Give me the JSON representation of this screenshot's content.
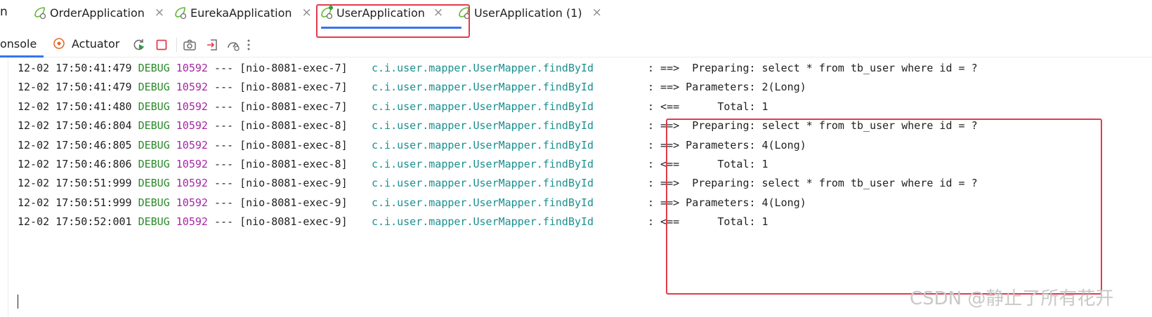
{
  "run_tabs": {
    "cut_label": "n",
    "items": [
      {
        "label": "OrderApplication",
        "close": "×"
      },
      {
        "label": "EurekaApplication",
        "close": "×"
      },
      {
        "label": "UserApplication",
        "close": "×",
        "selected": true
      },
      {
        "label": "UserApplication (1)",
        "close": "×"
      }
    ]
  },
  "toolbar": {
    "console_label": "onsole",
    "actuator_label": "Actuator",
    "icons": [
      "rerun-icon",
      "stop-icon",
      "camera-icon",
      "login-icon",
      "speed-gauge-icon",
      "more-vertical-icon"
    ]
  },
  "colors": {
    "accent": "#3574f0",
    "highlight_box": "#e23b4d",
    "debug_level": "#2a8a2a",
    "pid": "#a626a4",
    "logger": "#1b8f8f"
  },
  "log_lines": [
    {
      "ts": "12-02 17:50:41:479",
      "level": "DEBUG",
      "pid": "10592",
      "sep": "---",
      "thread": "[nio-8081-exec-7]",
      "logger": "c.i.user.mapper.UserMapper.findById",
      "msg": ": ==>  Preparing: select * from tb_user where id = ?"
    },
    {
      "ts": "12-02 17:50:41:479",
      "level": "DEBUG",
      "pid": "10592",
      "sep": "---",
      "thread": "[nio-8081-exec-7]",
      "logger": "c.i.user.mapper.UserMapper.findById",
      "msg": ": ==> Parameters: 2(Long)"
    },
    {
      "ts": "12-02 17:50:41:480",
      "level": "DEBUG",
      "pid": "10592",
      "sep": "---",
      "thread": "[nio-8081-exec-7]",
      "logger": "c.i.user.mapper.UserMapper.findById",
      "msg": ": <==      Total: 1"
    },
    {
      "ts": "12-02 17:50:46:804",
      "level": "DEBUG",
      "pid": "10592",
      "sep": "---",
      "thread": "[nio-8081-exec-8]",
      "logger": "c.i.user.mapper.UserMapper.findById",
      "msg": ": ==>  Preparing: select * from tb_user where id = ?"
    },
    {
      "ts": "12-02 17:50:46:805",
      "level": "DEBUG",
      "pid": "10592",
      "sep": "---",
      "thread": "[nio-8081-exec-8]",
      "logger": "c.i.user.mapper.UserMapper.findById",
      "msg": ": ==> Parameters: 4(Long)"
    },
    {
      "ts": "12-02 17:50:46:806",
      "level": "DEBUG",
      "pid": "10592",
      "sep": "---",
      "thread": "[nio-8081-exec-8]",
      "logger": "c.i.user.mapper.UserMapper.findById",
      "msg": ": <==      Total: 1"
    },
    {
      "ts": "12-02 17:50:51:999",
      "level": "DEBUG",
      "pid": "10592",
      "sep": "---",
      "thread": "[nio-8081-exec-9]",
      "logger": "c.i.user.mapper.UserMapper.findById",
      "msg": ": ==>  Preparing: select * from tb_user where id = ?"
    },
    {
      "ts": "12-02 17:50:51:999",
      "level": "DEBUG",
      "pid": "10592",
      "sep": "---",
      "thread": "[nio-8081-exec-9]",
      "logger": "c.i.user.mapper.UserMapper.findById",
      "msg": ": ==> Parameters: 4(Long)"
    },
    {
      "ts": "12-02 17:50:52:001",
      "level": "DEBUG",
      "pid": "10592",
      "sep": "---",
      "thread": "[nio-8081-exec-9]",
      "logger": "c.i.user.mapper.UserMapper.findById",
      "msg": ": <==      Total: 1"
    }
  ],
  "watermark": "CSDN @静止了所有花开"
}
